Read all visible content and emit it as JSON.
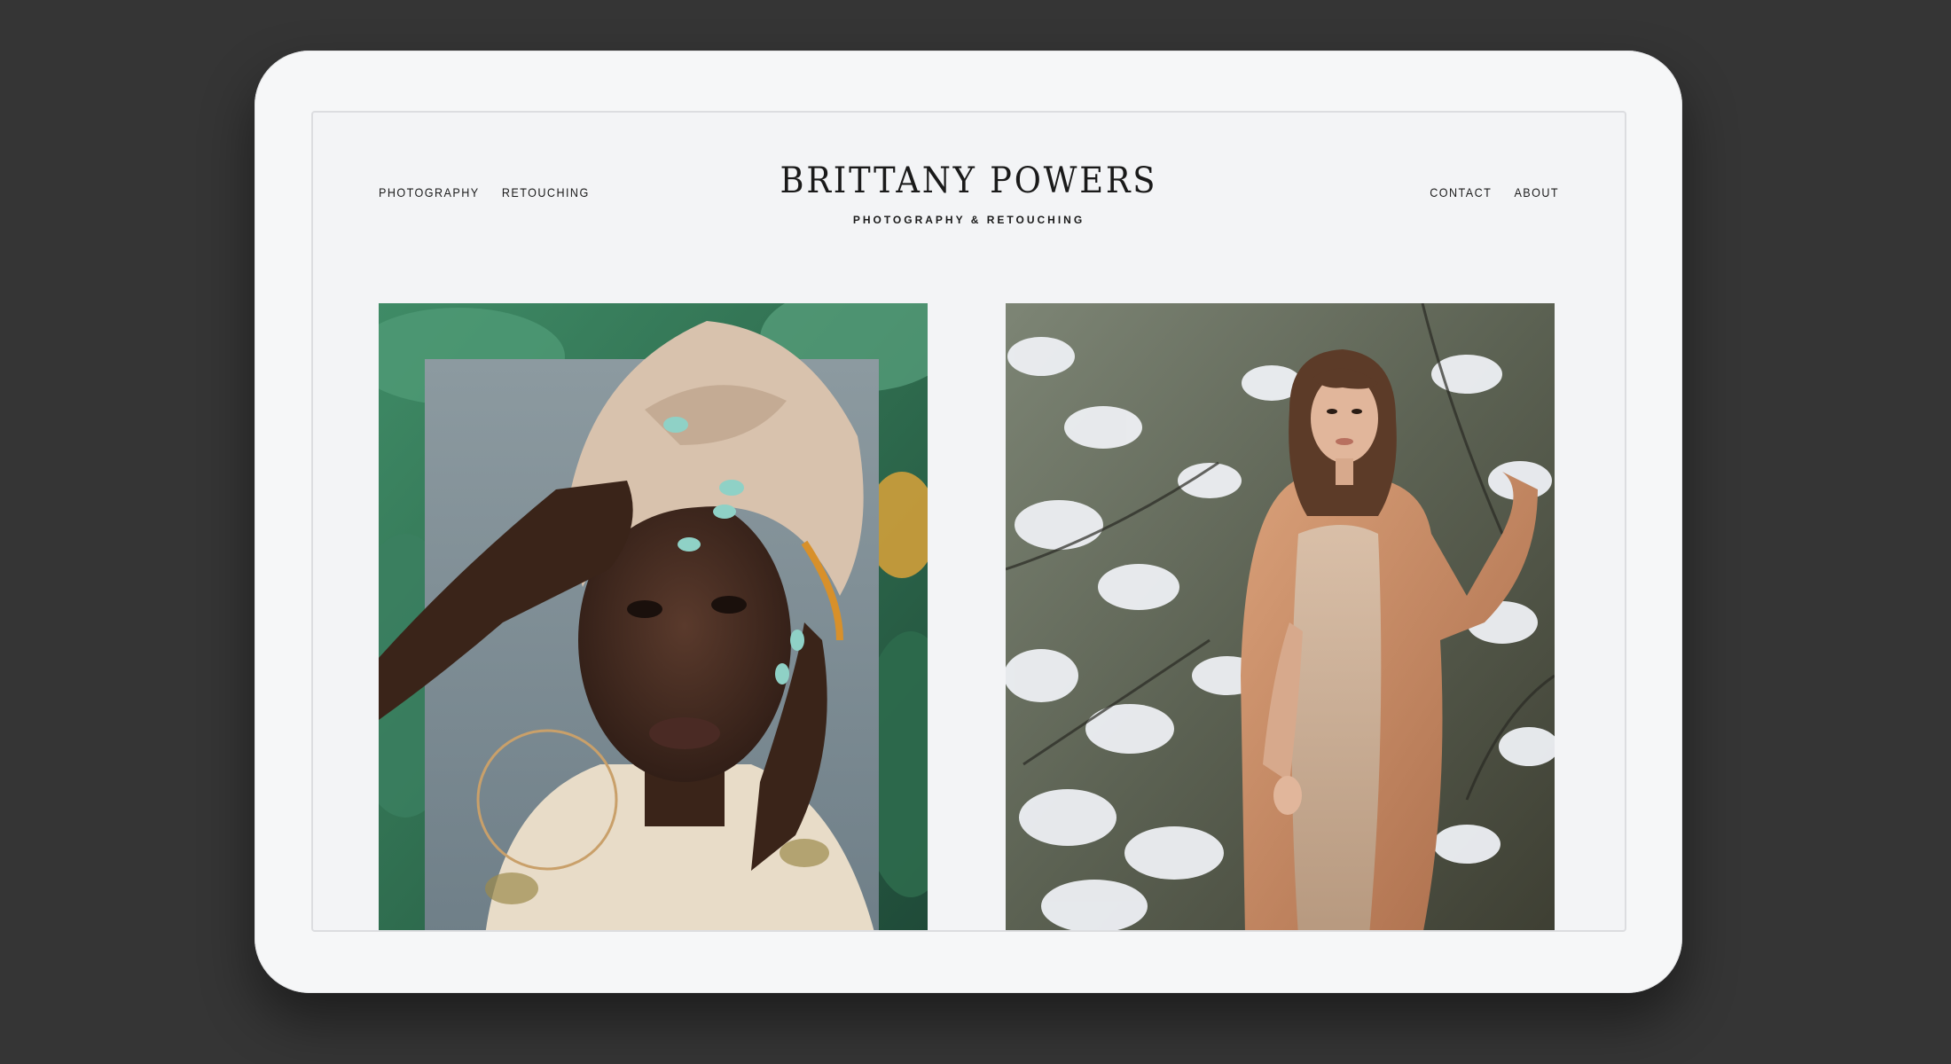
{
  "nav_left": [
    "PHOTOGRAPHY",
    "RETOUCHING"
  ],
  "nav_right": [
    "CONTACT",
    "ABOUT"
  ],
  "brand": {
    "name": "BRITTANY POWERS",
    "tagline": "PHOTOGRAPHY & RETOUCHING"
  },
  "colors": {
    "background": "#353535",
    "device": "#f6f7f8",
    "screen": "#f3f4f6",
    "text": "#1a1a1a"
  }
}
